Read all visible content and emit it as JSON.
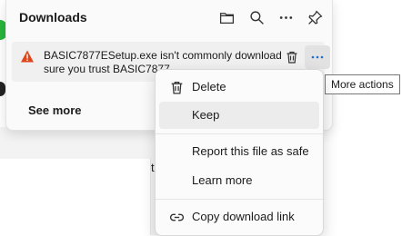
{
  "panel": {
    "title": "Downloads",
    "icons": [
      "folder-icon",
      "search-icon",
      "more-horizontal-icon",
      "pin-icon"
    ],
    "see_more": "See more"
  },
  "download_item": {
    "warning_icon": "warning-triangle-icon",
    "line1": "BASIC7877ESetup.exe isn't commonly download",
    "line2": "sure you trust BASIC7877",
    "accent_color": "#1f6fd0",
    "warning_color": "#e0461c"
  },
  "tooltip": "More actions",
  "menu": {
    "items": [
      {
        "label": "Delete",
        "icon": "trash-icon"
      },
      {
        "label": "Keep",
        "icon": ""
      },
      {
        "label": "Report this file as safe",
        "icon": ""
      },
      {
        "label": "Learn more",
        "icon": ""
      },
      {
        "label": "Copy download link",
        "icon": "link-icon"
      }
    ]
  },
  "background": {
    "partial_char": "t"
  }
}
